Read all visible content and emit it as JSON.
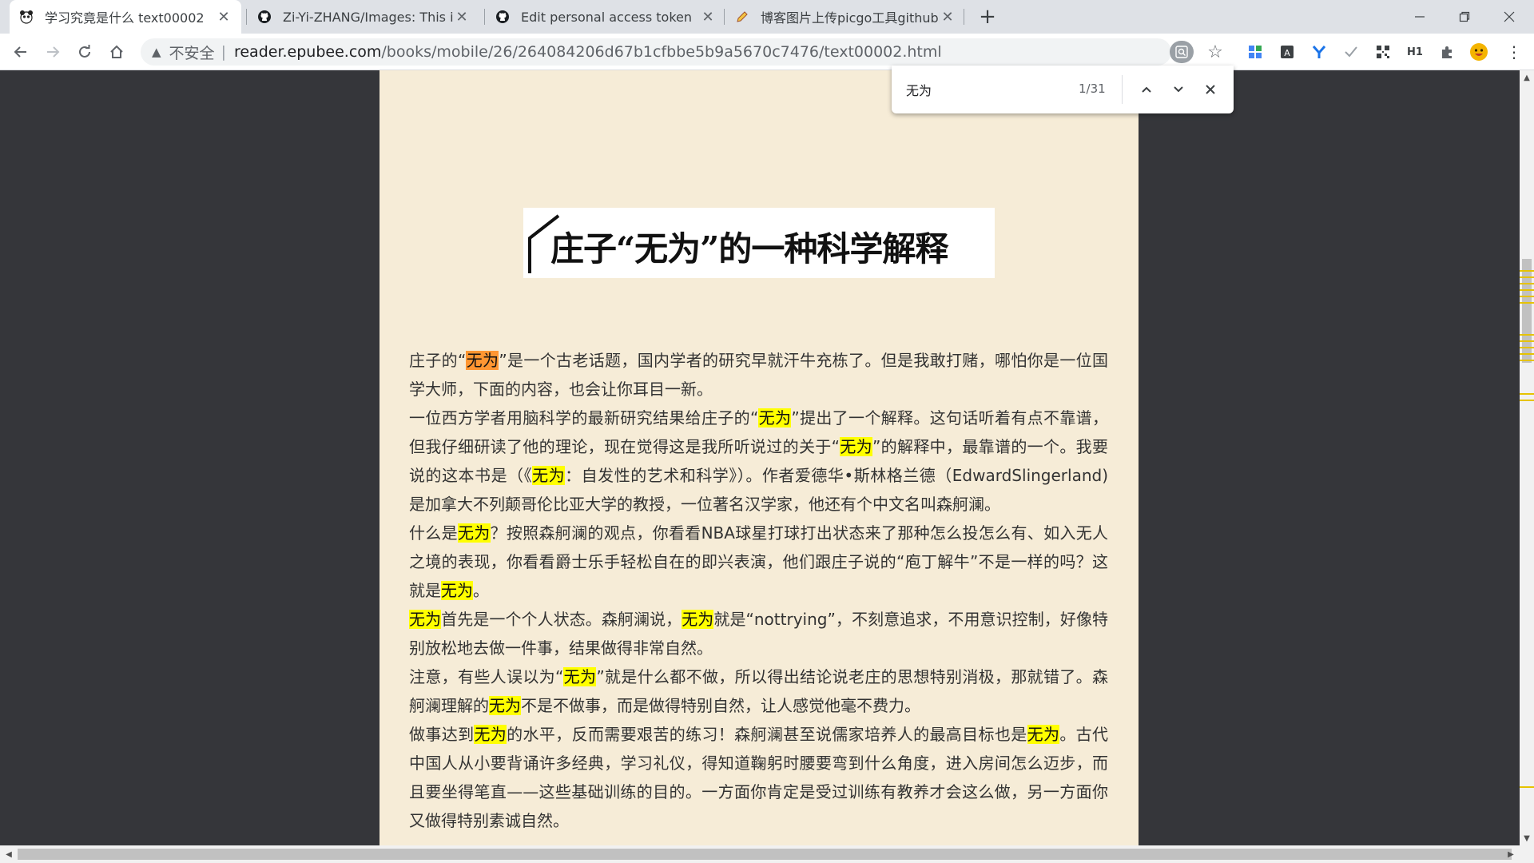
{
  "tabs": [
    {
      "title": "学习究竟是什么 text00002",
      "favicon": "panda-icon"
    },
    {
      "title": "Zi-Yi-ZHANG/Images: This is th",
      "favicon": "github-icon"
    },
    {
      "title": "Edit personal access token",
      "favicon": "github-icon"
    },
    {
      "title": "博客图片上传picgo工具github图",
      "favicon": "pencil-icon"
    }
  ],
  "toolbar": {
    "insecure_label": "不安全",
    "url_host": "reader.epubee.com",
    "url_path": "/books/mobile/26/264084206d67b1cfbbe5b9a5670c7476/text00002.html"
  },
  "find": {
    "query": "无为",
    "count": "1/31"
  },
  "article": {
    "heading": "庄子“无为”的一种科学解释",
    "p1": [
      {
        "t": "庄子的“"
      },
      {
        "t": "无为",
        "h": "cur"
      },
      {
        "t": "”是一个古老话题，国内学者的研究早就汗牛充栋了。但是我敢打赌，哪怕你是一位国学大师，下面的内容，也会让你耳目一新。"
      }
    ],
    "p2": [
      {
        "t": "一位西方学者用脑科学的最新研究结果给庄子的“"
      },
      {
        "t": "无为",
        "h": "hl"
      },
      {
        "t": "”提出了一个解释。这句话听着有点不靠谱，但我仔细研读了他的理论，现在觉得这是我所听说过的关于“"
      },
      {
        "t": "无为",
        "h": "hl"
      },
      {
        "t": "”的解释中，最靠谱的一个。我要说的这本书是（《"
      },
      {
        "t": "无为",
        "h": "hl"
      },
      {
        "t": "：自发性的艺术和科学》）。作者爱德华•斯林格兰德（EdwardSlingerland)是加拿大不列颠哥伦比亚大学的教授，一位著名汉学家，他还有个中文名叫森舸澜。"
      }
    ],
    "p3": [
      {
        "t": "什么是"
      },
      {
        "t": "无为",
        "h": "hl"
      },
      {
        "t": "？按照森舸澜的观点，你看看NBA球星打球打出状态来了那种怎么投怎么有、如入无人之境的表现，你看看爵士乐手轻松自在的即兴表演，他们跟庄子说的“庖丁解牛”不是一样的吗？这就是"
      },
      {
        "t": "无为",
        "h": "hl"
      },
      {
        "t": "。"
      }
    ],
    "p4": [
      {
        "t": "无为",
        "h": "hl"
      },
      {
        "t": "首先是一个个人状态。森舸澜说，"
      },
      {
        "t": "无为",
        "h": "hl"
      },
      {
        "t": "就是“nottrying”，不刻意追求，不用意识控制，好像特别放松地去做一件事，结果做得非常自然。"
      }
    ],
    "p5": [
      {
        "t": "注意，有些人误以为“"
      },
      {
        "t": "无为",
        "h": "hl"
      },
      {
        "t": "”就是什么都不做，所以得出结论说老庄的思想特别消极，那就错了。森舸澜理解的"
      },
      {
        "t": "无为",
        "h": "hl"
      },
      {
        "t": "不是不做事，而是做得特别自然，让人感觉他毫不费力。"
      }
    ],
    "p6": [
      {
        "t": "做事达到"
      },
      {
        "t": "无为",
        "h": "hl"
      },
      {
        "t": "的水平，反而需要艰苦的练习！森舸澜甚至说儒家培养人的最高目标也是"
      },
      {
        "t": "无为",
        "h": "hl"
      },
      {
        "t": "。古代中国人从小要背诵许多经典，学习礼仪，得知道鞠躬时腰要弯到什么角度，进入房间怎么迈步，而且要坐得笔直——这些基础训练的目的。一方面你肯定是受过训练有教养才会这么做，另一方面你又做得特别素诚自然。"
      }
    ]
  }
}
